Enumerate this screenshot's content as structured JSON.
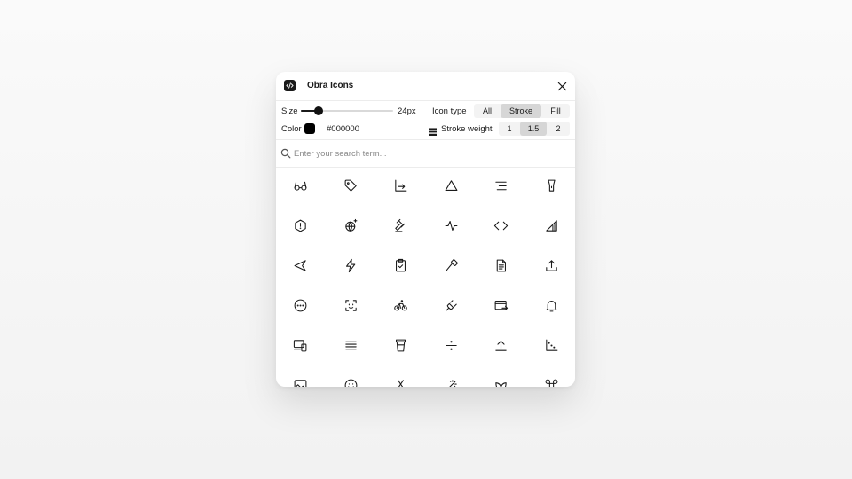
{
  "app": {
    "title": "Obra Icons"
  },
  "controls": {
    "size": {
      "label": "Size",
      "value": "24px",
      "fraction": 0.19
    },
    "icon_type": {
      "label": "Icon type",
      "options": [
        "All",
        "Stroke",
        "Fill"
      ],
      "selected": "Stroke"
    },
    "color": {
      "label": "Color",
      "value": "#000000"
    },
    "stroke_weight": {
      "label": "Stroke weight",
      "options": [
        "1",
        "1.5",
        "2"
      ],
      "selected": "1.5"
    }
  },
  "search": {
    "placeholder": "Enter your search term..."
  },
  "icons": [
    "glasses-icon",
    "tag-icon",
    "chart-axis-icon",
    "triangle-icon",
    "align-right-icon",
    "flashlight-icon",
    "alert-hexagon-icon",
    "globe-sparkle-icon",
    "gavel-icon",
    "activity-icon",
    "code-icon",
    "signal-icon",
    "send-icon",
    "lightning-icon",
    "clipboard-check-icon",
    "axe-icon",
    "file-text-icon",
    "upload-icon",
    "dots-circle-icon",
    "face-scan-icon",
    "bicycle-icon",
    "plug-icon",
    "card-transfer-icon",
    "bell-icon",
    "devices-icon",
    "align-justify-icon",
    "coffee-cup-icon",
    "divide-icon",
    "arrow-up-bar-icon",
    "scatter-chart-icon",
    "image-box-icon",
    "smile-icon",
    "scissors-icon",
    "magic-wand-icon",
    "leaf-icon",
    "command-icon"
  ]
}
